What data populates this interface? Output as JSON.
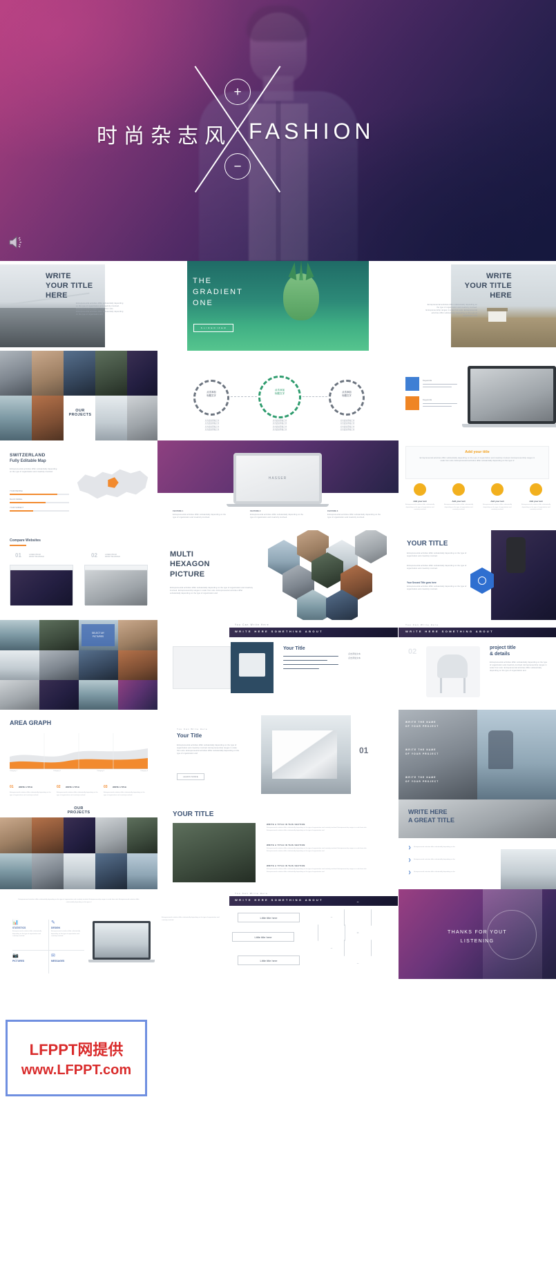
{
  "hero": {
    "title_cn": "时尚杂志风",
    "title_en": "FASHION",
    "plus": "+",
    "minus": "−",
    "speaker_icon": "speaker-icon",
    "colors": {
      "pink": "#b4407f",
      "purple": "#4e2a66",
      "navy": "#16183f"
    }
  },
  "watermark": {
    "line1": "LFPPT网提供",
    "line2": "www.LFPPT.com",
    "text_color": "#d92b2b",
    "border_color": "#6f8fe0"
  },
  "body_copy": {
    "lorem": "Entrepreneurial activities differ substantially depending on the type of organization and creativity involved. Entrepreneurship ranges in scale from solo. Entrepreneurial activities differ substantially depending on the type of organization and",
    "lorem_short": "Entrepreneurial activities differ substantially depending on the type of organization and creativity involved.",
    "lorem_wide": "Entrepreneurial activities differ substantially depending on the type of organization and creativity involved. Entrepreneurship ranges in scale from solo. Entrepreneurial activities differ substantially depending on the type of"
  },
  "rows": [
    {
      "id": "row-1",
      "slides": [
        {
          "id": "write-your-title-here-bridge",
          "kind": "title-photo-left",
          "title": "WRITE\nYOUR TITLE\nHERE",
          "photo": "bridge"
        },
        {
          "id": "the-gradient-one",
          "kind": "gradient-pineapple",
          "title": "THE\nGRADIENT\nONE",
          "button": "S L I D E D I Z E R"
        },
        {
          "id": "write-your-title-here-house",
          "kind": "title-photo-right",
          "title": "WRITE\nYOUR TITLE\nHERE",
          "photo": "house"
        }
      ]
    },
    {
      "id": "row-2",
      "slides": [
        {
          "id": "our-projects-collage-a",
          "kind": "collage-our-projects",
          "title": "OUR\nPROJECTS"
        },
        {
          "id": "three-dashed-circles",
          "kind": "circles",
          "circles": [
            "点击添加\n标题文字",
            "点击添加\n标题文字",
            "点击添加\n标题文字"
          ],
          "captions": [
            "点击此处添加正文\n点击此处添加正文\n点击此处添加正文\n点击此处添加正文",
            "点击此处添加正文\n点击此处添加正文\n点击此处添加正文\n点击此处添加正文",
            "点击此处添加正文\n点击此处添加正文\n点击此处添加正文\n点击此处添加正文"
          ]
        },
        {
          "id": "laptop-keywords",
          "kind": "laptop-cards",
          "cards": [
            "Keywords",
            "Keywords"
          ]
        }
      ]
    },
    {
      "id": "row-3",
      "slides": [
        {
          "id": "switzerland-map",
          "kind": "map",
          "title": "SWITZERLAND",
          "subtitle": "Fully Editable Map",
          "bars": [
            {
              "label": "YOUR PEOPLE",
              "value": "80%"
            },
            {
              "label": "BLACK MODEL",
              "value": "60%"
            },
            {
              "label": "YOUR SUBJECT",
              "value": "40%"
            }
          ]
        },
        {
          "id": "macbook-mockup",
          "kind": "macbook",
          "brand": "HASSER",
          "cols": [
            "FEATURE 1",
            "FEATURE 2",
            "FEATURE 3"
          ]
        },
        {
          "id": "add-your-title-icons",
          "kind": "four-icons",
          "title": "Add your title",
          "items": [
            "Add your text",
            "Add your text",
            "Add your text",
            "Add your text"
          ]
        }
      ]
    },
    {
      "id": "row-4",
      "slides": [
        {
          "id": "compare-websites",
          "kind": "compare",
          "title": "Compare Websites",
          "nums": [
            "01",
            "02"
          ],
          "labels": [
            "LOREM IPSUM\nFROM THE WORLD",
            "LOREM IPSUM\nFROM THE WORLD"
          ]
        },
        {
          "id": "multi-hexagon-picture",
          "kind": "hexagons",
          "title": "MULTI\nHEXAGON\nPICTURE"
        },
        {
          "id": "your-title-hexagon-badge",
          "kind": "hex-badge",
          "title": "YOUR TITLE",
          "sub": "Your Second Title goes here"
        }
      ]
    },
    {
      "id": "row-5",
      "slides": [
        {
          "id": "photo-grid-mosaic",
          "kind": "mosaic",
          "badge": "SELECT MY\nPICTURES"
        },
        {
          "id": "book-your-title",
          "kind": "book",
          "title": "Your Title",
          "eyebrow": "You Can Write Here",
          "banner": "WRITE HERE SOMETHING ABOUT"
        },
        {
          "id": "project-title-details",
          "kind": "chairs",
          "eyebrow": "You Can Write Here",
          "title": "project title\n& details",
          "banner": "WRITE HERE SOMETHING ABOUT",
          "num": "02"
        }
      ]
    },
    {
      "id": "row-6",
      "slides": [
        {
          "id": "area-graph",
          "kind": "area-graph",
          "title": "AREA GRAPH",
          "nums": [
            "01",
            "02",
            "03"
          ],
          "items": [
            "WRITE A TITLE",
            "WRITE A TITLE",
            "WRITE A TITLE"
          ]
        },
        {
          "id": "your-title-architecture",
          "kind": "architecture",
          "eyebrow": "You Can Write Here",
          "title": "Your Title",
          "button": "LEARN MORE",
          "num": "01"
        },
        {
          "id": "write-name-of-project",
          "kind": "two-photos",
          "cap1": "WRITE THE NAME\nOF YOUR PROJECT",
          "cap2": "WRITE THE NAME\nOF YOUR PROJECT",
          "cap3": "WRITE THE NAME\nOF YOUR PROJECT"
        }
      ]
    },
    {
      "id": "row-7",
      "slides": [
        {
          "id": "our-projects-collage-b",
          "kind": "collage-our-projects-2",
          "title": "OUR\nPROJECTS"
        },
        {
          "id": "your-title-aerial",
          "kind": "aerial",
          "title": "YOUR TITLE",
          "sections": [
            "WRITE A TITLE IN THIS SECTION",
            "WRITE A TITLE IN THIS SECTION",
            "WRITE A TITLE IN THIS SECTION"
          ]
        },
        {
          "id": "write-here-a-great-title",
          "kind": "bullets",
          "title": "WRITE HERE\nA GREAT TITLE",
          "bullets": [
            "Entrepreneurial activities differ substantially depending on the",
            "Entrepreneurial activities differ substantially depending on the",
            "Entrepreneurial activities differ substantially depending on the"
          ]
        }
      ]
    },
    {
      "id": "row-8",
      "slides": [
        {
          "id": "statistics-design-pictures-messages",
          "kind": "four-quadrants",
          "items": [
            "STATISTICS",
            "DESIGN",
            "PICTURES",
            "MESSAGES"
          ]
        },
        {
          "id": "little-title-here-hexagons",
          "kind": "little-titles",
          "eyebrow": "You Can Write Here",
          "banner": "WRITE HERE SOMETHING ABOUT",
          "tiles": [
            "Little title here",
            "Little title here",
            "Little title here"
          ]
        },
        {
          "id": "thanks-for-your-listening",
          "kind": "thanks",
          "title": "THANKS FOR YOUT\nLISTENING"
        }
      ]
    }
  ]
}
